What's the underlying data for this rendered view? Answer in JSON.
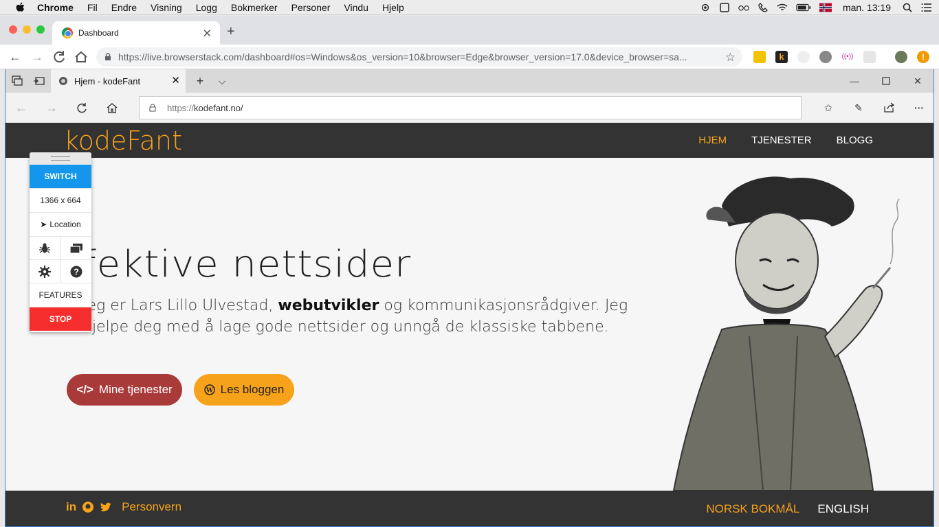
{
  "menubar": {
    "app": "Chrome",
    "items": [
      "Fil",
      "Endre",
      "Visning",
      "Logg",
      "Bokmerker",
      "Personer",
      "Vindu",
      "Hjelp"
    ],
    "clock": "man. 13:19"
  },
  "chrome": {
    "tab_title": "Dashboard",
    "url": "https://live.browserstack.com/dashboard#os=Windows&os_version=10&browser=Edge&browser_version=17.0&device_browser=sa..."
  },
  "edge": {
    "tab_title": "Hjem - kodeFant",
    "url_protocol": "https://",
    "url_host": "kodefant.no/"
  },
  "site": {
    "logo": "kodeFant",
    "nav": [
      "HJEM",
      "TJENESTER",
      "BLOGG"
    ],
    "hero_title": "fektive nettsider",
    "hero_text_1": "Jeg er Lars Lillo Ulvestad, ",
    "hero_text_bold": "webutvikler",
    "hero_text_2": " og kommunikasjonsrådgiver. Jeg hjelpe deg med å lage gode nettsider og unngå de klassiske tabbene.",
    "btn_services": "Mine tjenester",
    "btn_blog": "Les bloggen",
    "footer_privacy": "Personvern",
    "lang_no": "NORSK BOKMÅL",
    "lang_en": "ENGLISH"
  },
  "browserstack": {
    "switch": "SWITCH",
    "resolution": "1366 x 664",
    "location": "Location",
    "features": "FEATURES",
    "stop": "STOP"
  },
  "colors": {
    "accent": "#f7a21b",
    "dark": "#333333",
    "red_button": "#a83a3a",
    "switch_blue": "#1396ec",
    "stop_red": "#f52d2d"
  }
}
